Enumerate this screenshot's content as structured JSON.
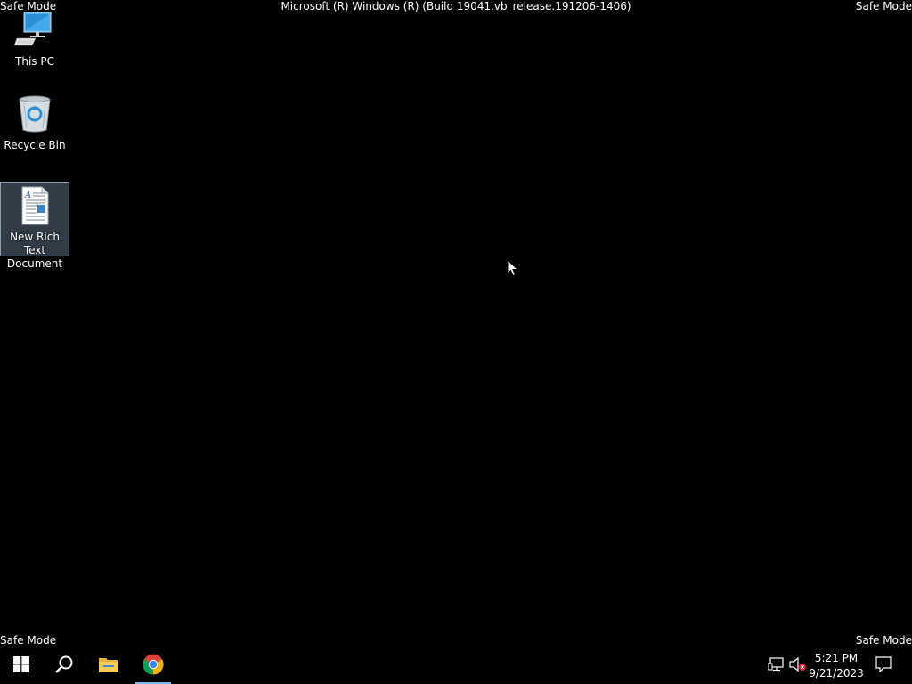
{
  "screen": {
    "safe_mode_top_left": "Safe Mode",
    "safe_mode_top_right": "Safe Mode",
    "safe_mode_bottom_left": "Safe Mode",
    "safe_mode_bottom_right": "Safe Mode",
    "build_title": "Microsoft (R) Windows (R) (Build 19041.vb_release.191206-1406)",
    "background_color": "#000000"
  },
  "desktop_icons": [
    {
      "label": "This PC",
      "icon": "this-pc-icon",
      "selected": false
    },
    {
      "label": "Recycle Bin",
      "icon": "recycle-bin-icon",
      "selected": false
    },
    {
      "label": "New Rich Text Document",
      "icon": "rich-text-document-icon",
      "selected": true
    }
  ],
  "taskbar": {
    "items": [
      {
        "name": "start",
        "icon": "windows-logo-icon"
      },
      {
        "name": "search",
        "icon": "search-icon"
      },
      {
        "name": "file-explorer",
        "icon": "folder-icon"
      },
      {
        "name": "google-chrome",
        "icon": "chrome-icon",
        "active": true
      }
    ],
    "tray": {
      "network_icon": "network-icon",
      "volume_icon": "volume-muted-icon",
      "time": "5:21 PM",
      "date": "9/21/2023",
      "notifications_icon": "notification-icon"
    },
    "accent_color": "#76b9ed"
  }
}
